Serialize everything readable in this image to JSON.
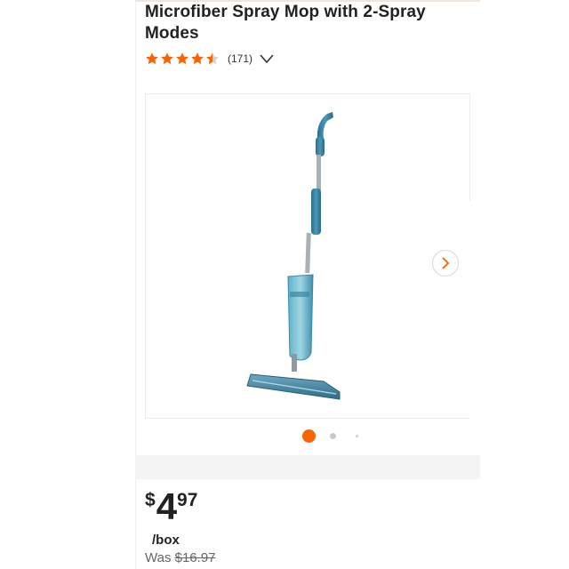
{
  "product": {
    "title": "Microfiber Spray Mop with 2-Spray Modes",
    "rating": 4.5,
    "review_count_text": "(171)"
  },
  "gallery": {
    "image_icon": "spray-mop-image",
    "next_icon": "chevron-right-icon",
    "pager": {
      "current": 1,
      "total": 3
    }
  },
  "price": {
    "currency": "$",
    "dollars": "4",
    "cents": "97",
    "unit": "/box",
    "was_label": "Was",
    "was_price": "$16.97"
  },
  "colors": {
    "accent": "#f96302",
    "star": "#f96302",
    "text": "#222222"
  }
}
